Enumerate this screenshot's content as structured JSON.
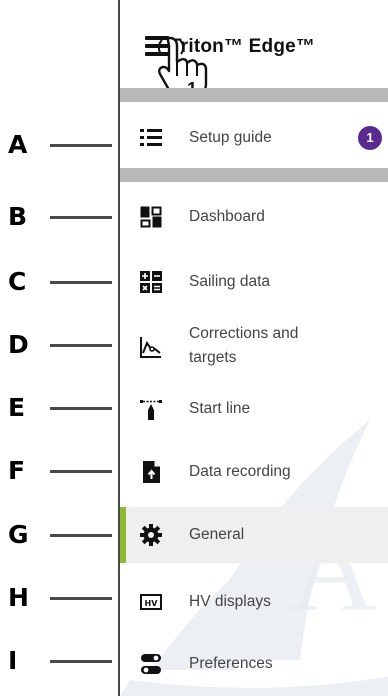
{
  "header": {
    "title": "Triton™ Edge™",
    "step_number": "1"
  },
  "menu": {
    "setup_guide": {
      "label": "Setup guide",
      "badge": "1"
    },
    "items": [
      {
        "label": "Dashboard"
      },
      {
        "label": "Sailing data"
      },
      {
        "label": "Corrections and targets"
      },
      {
        "label": "Start line"
      },
      {
        "label": "Data recording"
      },
      {
        "label": "General",
        "selected": true
      },
      {
        "label": "HV displays"
      },
      {
        "label": "Preferences"
      }
    ]
  },
  "callouts": [
    "A",
    "B",
    "C",
    "D",
    "E",
    "F",
    "G",
    "H",
    "I"
  ],
  "colors": {
    "selected_bar": "#8dbb2e",
    "badge": "#5b2a90",
    "divider": "#b9b9b9"
  }
}
